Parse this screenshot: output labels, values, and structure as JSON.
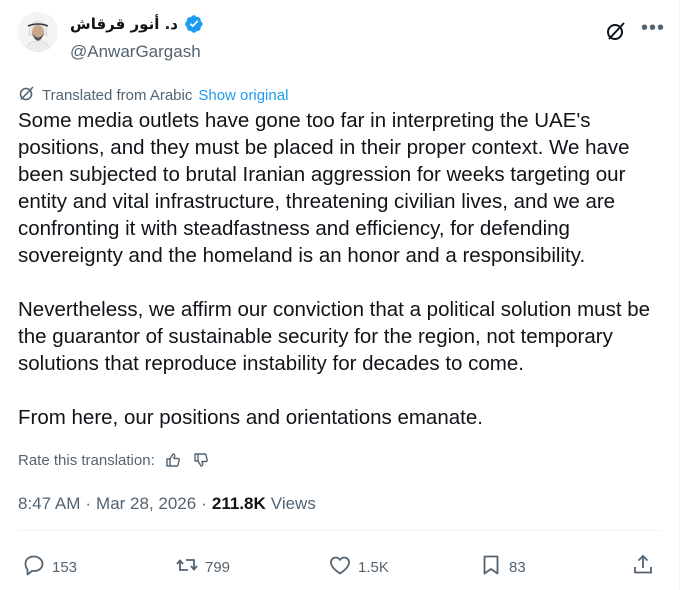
{
  "author": {
    "display_name": "د. أنور قرقاش",
    "handle": "@AnwarGargash",
    "verified": true
  },
  "translation": {
    "label": "Translated from Arabic",
    "show_original": "Show original"
  },
  "tweet": {
    "paragraphs": [
      "Some media outlets have gone too far in interpreting the UAE's positions, and they must be placed in their proper context. We have been subjected to brutal Iranian aggression for weeks targeting our entity and vital infrastructure, threatening civilian lives, and we are confronting it with steadfastness and efficiency, for defending sovereignty and the homeland is an honor and a responsibility.",
      "Nevertheless, we affirm our conviction that a political solution must be the guarantor of sustainable security for the region, not temporary solutions that reproduce instability for decades to come.",
      "From here, our positions and orientations emanate."
    ]
  },
  "rate": {
    "label": "Rate this translation:"
  },
  "meta": {
    "time": "8:47 AM",
    "separator": "·",
    "date": "Mar 28, 2026",
    "views_count": "211.8K",
    "views_label": "Views"
  },
  "actions": {
    "replies": "153",
    "reposts": "799",
    "likes": "1.5K",
    "bookmarks": "83"
  },
  "colors": {
    "text": "#0f1419",
    "secondary": "#536471",
    "link": "#1d9bf0",
    "verified": "#1d9bf0"
  },
  "icons": [
    "grok-icon",
    "more-icon",
    "translate-icon",
    "thumbs-up-icon",
    "thumbs-down-icon",
    "reply-icon",
    "repost-icon",
    "like-icon",
    "bookmark-icon",
    "share-icon",
    "verified-badge-icon"
  ]
}
